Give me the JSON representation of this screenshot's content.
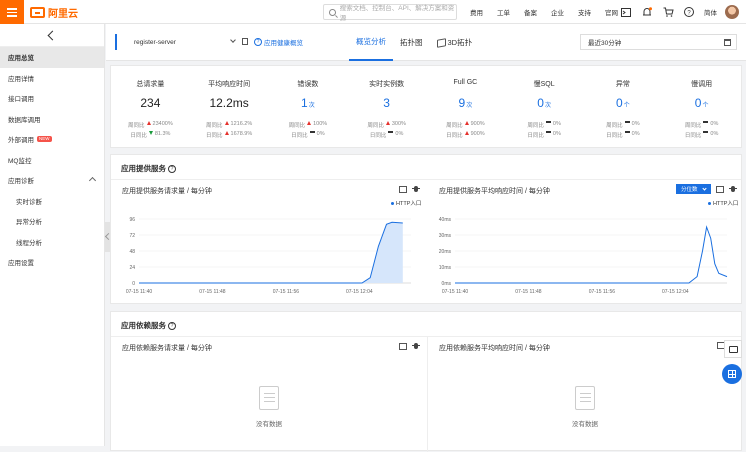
{
  "topbar": {
    "logo_text": "阿里云",
    "search_placeholder": "搜索文档、控制台、API、解决方案和资源",
    "nav": [
      "费用",
      "工单",
      "备案",
      "企业",
      "支持",
      "官网"
    ],
    "username": "简体"
  },
  "sidebar": {
    "items": [
      {
        "label": "应用总览",
        "active": true,
        "sub": false
      },
      {
        "label": "应用详情",
        "active": false,
        "sub": false
      },
      {
        "label": "接口调用",
        "active": false,
        "sub": false
      },
      {
        "label": "数据库调用",
        "active": false,
        "sub": false
      },
      {
        "label": "外部调用",
        "active": false,
        "sub": false,
        "badge": "NEW"
      },
      {
        "label": "MQ监控",
        "active": false,
        "sub": false
      },
      {
        "label": "应用诊断",
        "active": false,
        "sub": false,
        "expanded": true
      },
      {
        "label": "实时诊断",
        "active": false,
        "sub": true
      },
      {
        "label": "异常分析",
        "active": false,
        "sub": true
      },
      {
        "label": "线程分析",
        "active": false,
        "sub": true
      },
      {
        "label": "应用设置",
        "active": false,
        "sub": false
      }
    ]
  },
  "subheader": {
    "app_name": "register-server",
    "health_link": "应用健康概览",
    "tabs": [
      {
        "label": "概览分析",
        "active": true
      },
      {
        "label": "拓扑图",
        "active": false
      },
      {
        "label": "3D拓扑",
        "active": false
      }
    ],
    "time_range": "最近30分钟"
  },
  "stats": [
    {
      "label": "总请求量",
      "value": "234",
      "unit": "",
      "blue": false,
      "week": {
        "label": "周同比",
        "dir": "up",
        "val": "23400%"
      },
      "day": {
        "label": "日同比",
        "dir": "down",
        "val": "81.3%"
      }
    },
    {
      "label": "平均响应时间",
      "value": "12.2ms",
      "unit": "",
      "blue": false,
      "week": {
        "label": "周同比",
        "dir": "up",
        "val": "1216.2%"
      },
      "day": {
        "label": "日同比",
        "dir": "up",
        "val": "1678.9%"
      }
    },
    {
      "label": "错误数",
      "value": "1",
      "unit": "次",
      "blue": true,
      "week": {
        "label": "周同比",
        "dir": "up",
        "val": "100%"
      },
      "day": {
        "label": "日同比",
        "dir": "flat",
        "val": "0%"
      }
    },
    {
      "label": "实时实例数",
      "value": "3",
      "unit": "",
      "blue": true,
      "week": {
        "label": "周同比",
        "dir": "up",
        "val": "300%"
      },
      "day": {
        "label": "日同比",
        "dir": "flat",
        "val": "0%"
      }
    },
    {
      "label": "Full GC",
      "value": "9",
      "unit": "次",
      "blue": true,
      "week": {
        "label": "周同比",
        "dir": "up",
        "val": "900%"
      },
      "day": {
        "label": "日同比",
        "dir": "up",
        "val": "900%"
      }
    },
    {
      "label": "慢SQL",
      "value": "0",
      "unit": "次",
      "blue": true,
      "week": {
        "label": "周同比",
        "dir": "flat",
        "val": "0%"
      },
      "day": {
        "label": "日同比",
        "dir": "flat",
        "val": "0%"
      }
    },
    {
      "label": "异常",
      "value": "0",
      "unit": "个",
      "blue": true,
      "week": {
        "label": "周同比",
        "dir": "flat",
        "val": "0%"
      },
      "day": {
        "label": "日同比",
        "dir": "flat",
        "val": "0%"
      }
    },
    {
      "label": "慢调用",
      "value": "0",
      "unit": "个",
      "blue": true,
      "week": {
        "label": "周同比",
        "dir": "flat",
        "val": "0%"
      },
      "day": {
        "label": "日同比",
        "dir": "flat",
        "val": "0%"
      }
    }
  ],
  "provider_panel": {
    "title": "应用提供服务",
    "left_title": "应用提供服务请求量 / 每分钟",
    "right_title": "应用提供服务平均响应时间 / 每分钟",
    "split_btn": "分位数"
  },
  "dependency_panel": {
    "title": "应用依赖服务",
    "left_title": "应用依赖服务请求量 / 每分钟",
    "right_title": "应用依赖服务平均响应时间 / 每分钟",
    "empty_text": "没有数据"
  },
  "chart_data": [
    {
      "type": "area",
      "title": "应用提供服务请求量 / 每分钟",
      "series": [
        {
          "name": "HTTP入口",
          "color": "#1a6fe0"
        }
      ],
      "x": [
        "07-15 11:40",
        "07-15 11:48",
        "07-15 11:56",
        "07-15 12:04"
      ],
      "yticks": [
        "0",
        "24",
        "48",
        "72",
        "96"
      ],
      "ylim": [
        0,
        96
      ],
      "points": [
        [
          0,
          0
        ],
        [
          0.5,
          0
        ],
        [
          0.6,
          0
        ],
        [
          0.7,
          0
        ],
        [
          0.82,
          0
        ],
        [
          0.85,
          8
        ],
        [
          0.88,
          55
        ],
        [
          0.91,
          88
        ],
        [
          0.93,
          91
        ],
        [
          0.97,
          90
        ]
      ]
    },
    {
      "type": "line",
      "title": "应用提供服务平均响应时间 / 每分钟",
      "series": [
        {
          "name": "HTTP入口",
          "color": "#1a6fe0"
        }
      ],
      "x": [
        "07-15 11:40",
        "07-15 11:48",
        "07-15 11:56",
        "07-15 12:04"
      ],
      "yticks": [
        "0ms",
        "10ms",
        "20ms",
        "30ms",
        "40ms"
      ],
      "ylim": [
        0,
        40
      ],
      "points": [
        [
          0,
          0
        ],
        [
          0.86,
          0
        ],
        [
          0.89,
          4
        ],
        [
          0.91,
          20
        ],
        [
          0.925,
          35
        ],
        [
          0.94,
          28
        ],
        [
          0.955,
          12
        ],
        [
          0.97,
          6
        ],
        [
          1.0,
          4
        ]
      ]
    }
  ]
}
